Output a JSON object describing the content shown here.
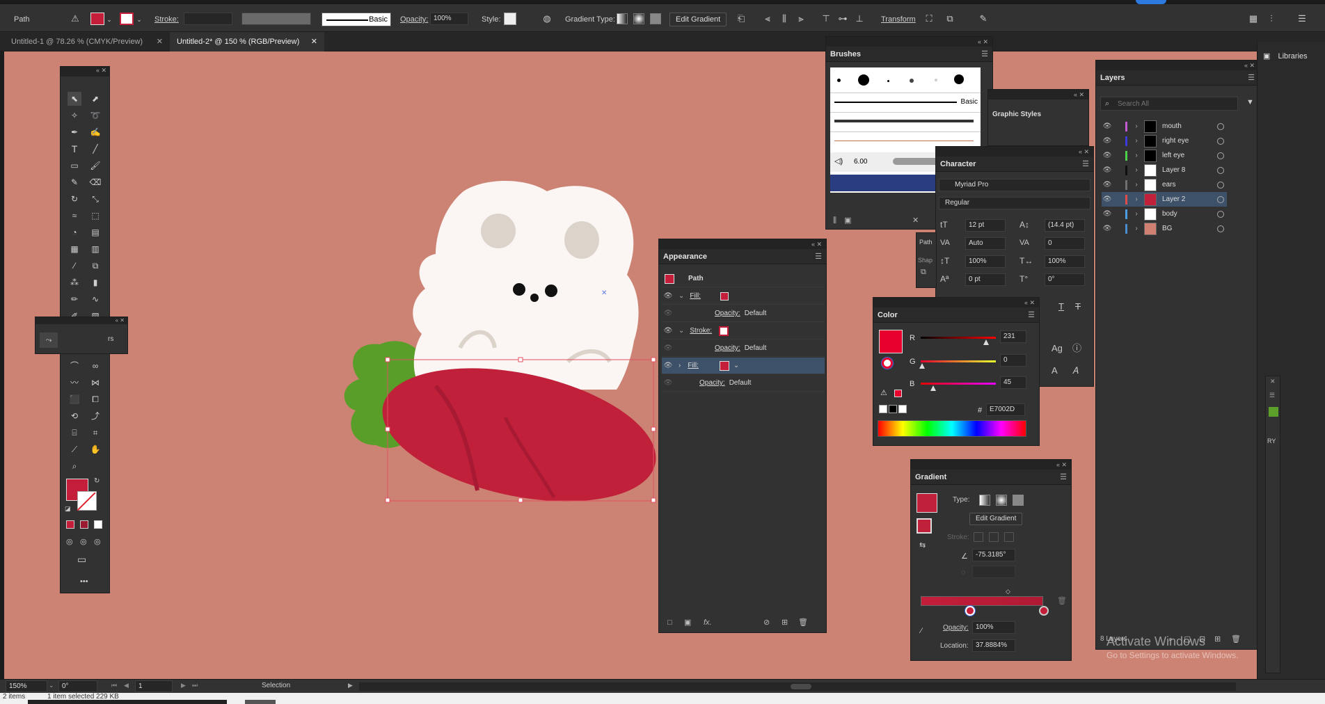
{
  "control_bar": {
    "selection_type": "Path",
    "stroke_label": "Stroke:",
    "brush_label": "Basic",
    "opacity_label": "Opacity:",
    "opacity_value": "100%",
    "style_label": "Style:",
    "gradient_type_label": "Gradient Type:",
    "edit_gradient": "Edit Gradient",
    "transform": "Transform"
  },
  "tabs": [
    {
      "label": "Untitled-1 @ 78.26 % (CMYK/Preview)"
    },
    {
      "label": "Untitled-2* @ 150 % (RGB/Preview)"
    }
  ],
  "libraries_label": "Libraries",
  "brushes": {
    "title": "Brushes",
    "basic_label": "Basic",
    "size_value": "6.00"
  },
  "graphic_styles": {
    "title": "Graphic Styles"
  },
  "character": {
    "title": "Character",
    "font_family": "Myriad Pro",
    "font_style": "Regular",
    "font_size": "12 pt",
    "leading": "(14.4 pt)",
    "kerning": "Auto",
    "tracking": "0",
    "v_scale": "100%",
    "h_scale": "100%",
    "baseline": "0 pt",
    "rotation": "0°"
  },
  "appearance": {
    "title": "Appearance",
    "header": "Path",
    "fill_label": "Fill:",
    "stroke_label": "Stroke:",
    "opacity_label": "Opacity:",
    "opacity_value": "Default",
    "fx_label": "fx."
  },
  "color": {
    "title": "Color",
    "r_label": "R",
    "r_value": "231",
    "g_label": "G",
    "g_value": "0",
    "b_label": "B",
    "b_value": "45",
    "hash_label": "#",
    "hex_value": "E7002D",
    "accent": "#e7002d"
  },
  "gradient": {
    "title": "Gradient",
    "type_label": "Type:",
    "edit_gradient": "Edit Gradient",
    "stroke_label": "Stroke:",
    "angle": "-75.3185°",
    "opacity_label": "Opacity:",
    "opacity_value": "100%",
    "location_label": "Location:",
    "location_value": "37.8884%",
    "location_fraction": 0.378884
  },
  "layers": {
    "title": "Layers",
    "search_placeholder": "Search All",
    "items": [
      {
        "name": "mouth",
        "color": "#c45ad2",
        "thumb": "#000000"
      },
      {
        "name": "right eye",
        "color": "#3c3cdc",
        "thumb": "#000000"
      },
      {
        "name": "left eye",
        "color": "#4cd24c",
        "thumb": "#000000"
      },
      {
        "name": "Layer 8",
        "color": "#101010",
        "thumb": "#ffffff"
      },
      {
        "name": "ears",
        "color": "#707070",
        "thumb": "#ffffff"
      },
      {
        "name": "Layer 2",
        "color": "#e04c4c",
        "thumb": "#c0203a"
      },
      {
        "name": "body",
        "color": "#4c9ce0",
        "thumb": "#ffffff"
      },
      {
        "name": "BG",
        "color": "#4c8cd0",
        "thumb": "#d08070"
      }
    ],
    "footer_count": "8 Layers"
  },
  "status_bar": {
    "zoom": "150%",
    "rotation": "0°",
    "artboard": "1",
    "tool": "Selection",
    "bottom_left": "2 items",
    "bottom_mid": "1 item selected   229 KB"
  },
  "watermark": {
    "line1": "Activate Windows",
    "line2": "Go to Settings to activate Windows."
  },
  "floating_label": "rs",
  "right_edge_label": "RY"
}
